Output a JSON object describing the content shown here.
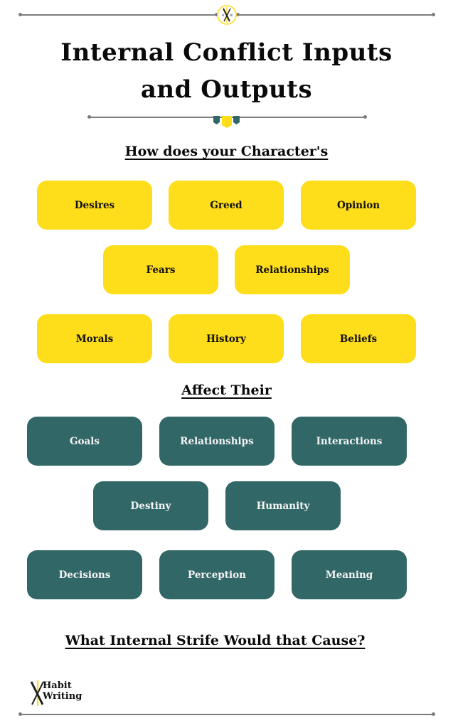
{
  "header": {
    "emblem_icon": "crossed-pens-emblem-icon",
    "title_line1": "Internal Conflict Inputs",
    "title_line2": "and Outputs"
  },
  "section_inputs": {
    "heading": "How does your Character's",
    "color": "#fedd1a",
    "rows": [
      [
        "Desires",
        "Greed",
        "Opinion"
      ],
      [
        "Fears",
        "Relationships"
      ],
      [
        "Morals",
        "History",
        "Beliefs"
      ]
    ]
  },
  "section_outputs": {
    "heading": "Affect Their",
    "color": "#316766",
    "rows": [
      [
        "Goals",
        "Relationships",
        "Interactions"
      ],
      [
        "Destiny",
        "Humanity"
      ],
      [
        "Decisions",
        "Perception",
        "Meaning"
      ]
    ]
  },
  "closing_question": "What Internal Strife Would that Cause?",
  "footer": {
    "logo_icon": "crossed-pens-logo-icon",
    "brand_line1": "Habit",
    "brand_line2": "Writing"
  },
  "colors": {
    "yellow": "#fedd1a",
    "teal": "#316766",
    "rule_gray": "#7d7d7d"
  }
}
